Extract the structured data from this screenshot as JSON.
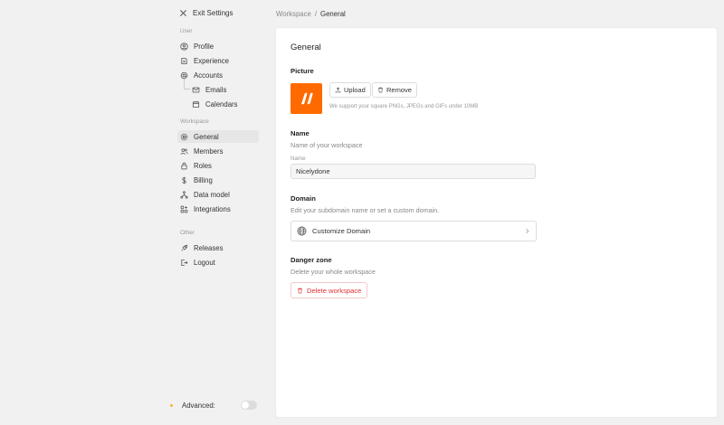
{
  "sidebar": {
    "exit_label": "Exit Settings",
    "sections": {
      "user": "User",
      "workspace": "Workspace",
      "other": "Other"
    },
    "user_items": {
      "profile": "Profile",
      "experience": "Experience",
      "accounts": "Accounts",
      "emails": "Emails",
      "calendars": "Calendars"
    },
    "workspace_items": {
      "general": "General",
      "members": "Members",
      "roles": "Roles",
      "billing": "Billing",
      "data_model": "Data model",
      "integrations": "Integrations"
    },
    "other_items": {
      "releases": "Releases",
      "logout": "Logout"
    },
    "advanced_label": "Advanced:",
    "advanced_enabled": false
  },
  "breadcrumb": {
    "parent": "Workspace",
    "separator": "/",
    "current": "General"
  },
  "main": {
    "title": "General",
    "picture": {
      "title": "Picture",
      "upload_label": "Upload",
      "remove_label": "Remove",
      "hint": "We support your square PNGs, JPEGs and GIFs under 10MB",
      "logo_color": "#ff6a00"
    },
    "name": {
      "title": "Name",
      "description": "Name of your workspace",
      "field_label": "Name",
      "value": "Nicelydone"
    },
    "domain": {
      "title": "Domain",
      "description": "Edit your subdomain name or set a custom domain.",
      "row_label": "Customize Domain"
    },
    "danger": {
      "title": "Danger zone",
      "description": "Delete your whole workspace",
      "delete_label": "Delete workspace",
      "color": "#e03131"
    }
  }
}
